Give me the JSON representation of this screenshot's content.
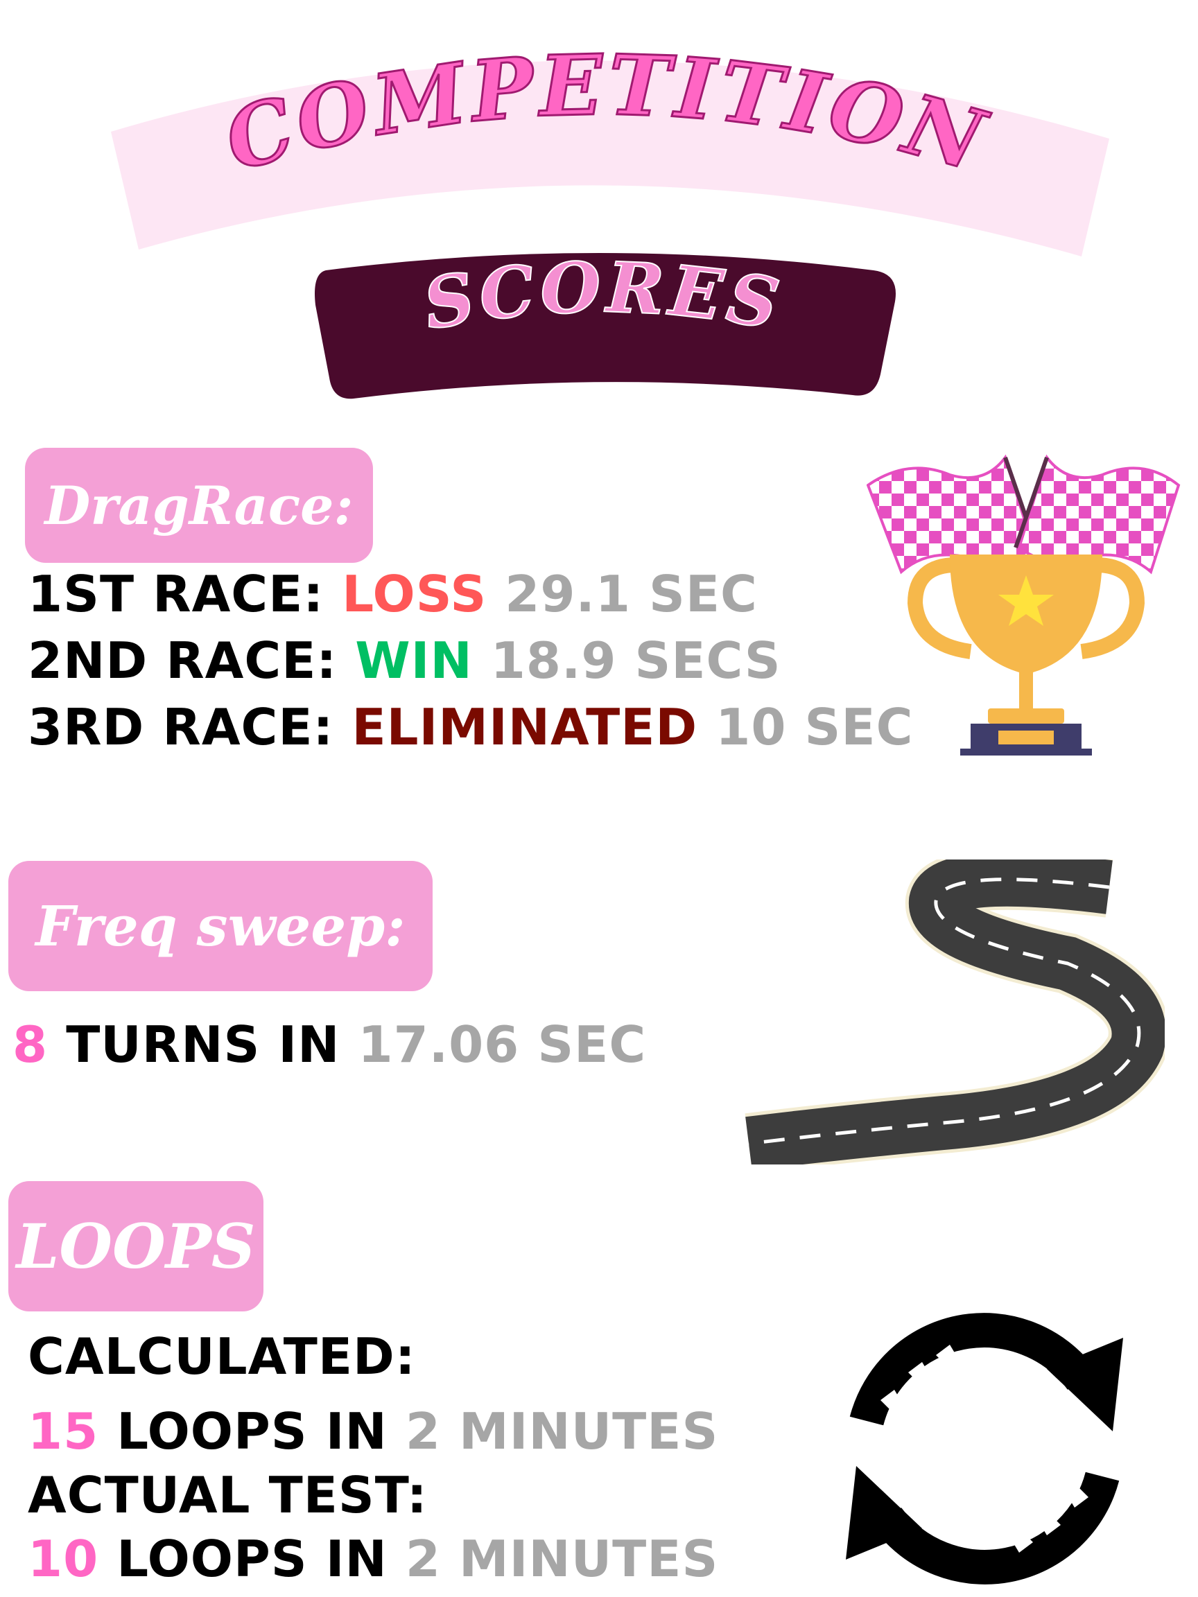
{
  "header": {
    "title": "COMPETITION",
    "subtitle": "SCORES"
  },
  "colors": {
    "title_band": "#fde6f4",
    "title_text": "#ff66c4",
    "subtitle_band": "#4a0a2c",
    "subtitle_text": "#f48fd1",
    "tag_bg": "#f4a0d6",
    "loss": "#ff5757",
    "win": "#00bf63",
    "eliminated": "#7a0a00",
    "count": "#ff66c4",
    "time": "#a6a6a6"
  },
  "drag_race": {
    "label": "DragRace:",
    "icon": "trophy-flags-icon",
    "races": [
      {
        "name": "1ST RACE:",
        "result": "LOSS",
        "time": "29.1 SEC"
      },
      {
        "name": "2ND RACE:",
        "result": "WIN",
        "time": "18.9 SECS"
      },
      {
        "name": "3RD RACE:",
        "result": "ELIMINATED",
        "time": "10 SEC"
      }
    ]
  },
  "freq_sweep": {
    "label": "Freq sweep:",
    "icon": "road-icon",
    "count": "8",
    "text": "TURNS IN",
    "time": "17.06 SEC"
  },
  "loops": {
    "label": "LOOPS",
    "icon": "loop-arrows-icon",
    "calculated_label": "CALCULATED:",
    "calculated": {
      "count": "15",
      "text": "LOOPS IN",
      "time": "2 MINUTES"
    },
    "actual_label": "ACTUAL TEST:",
    "actual": {
      "count": "10",
      "text": "LOOPS IN",
      "time": "2 MINUTES"
    }
  }
}
